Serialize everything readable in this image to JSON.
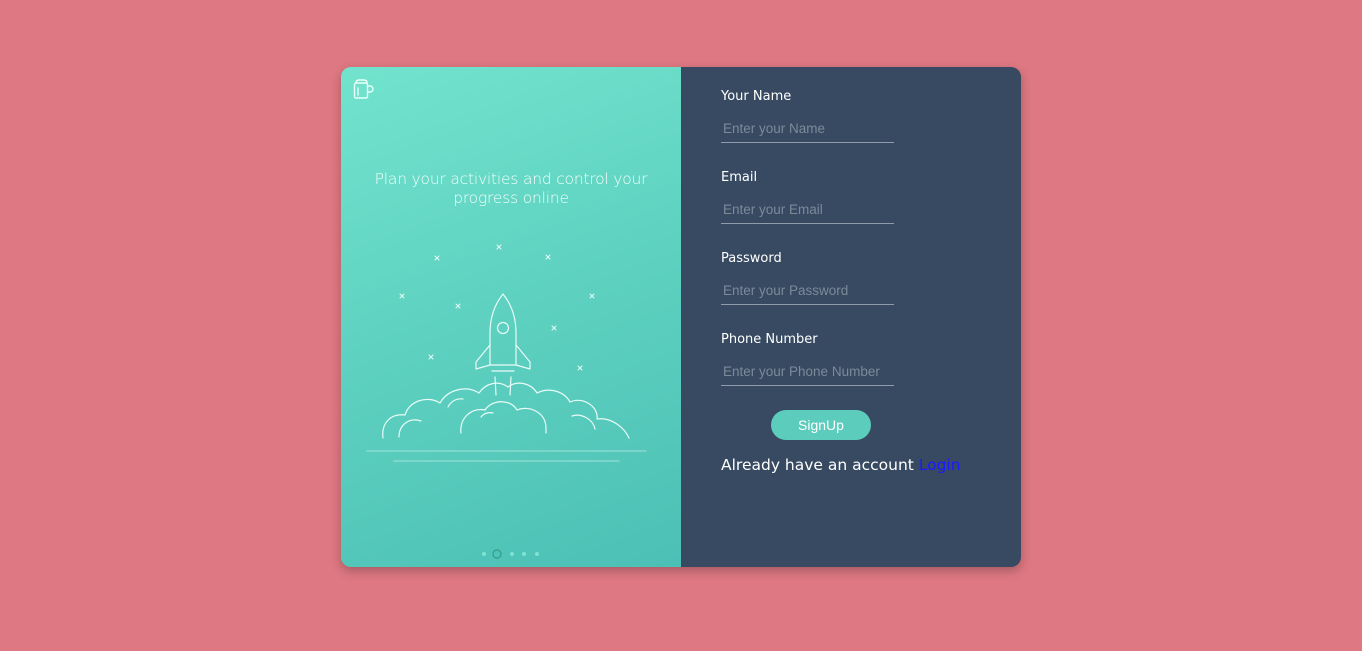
{
  "hero": {
    "logo_icon": "cup-icon",
    "tagline": "Plan your activities and control your progress online",
    "illustration_icon": "rocket-launch-illustration",
    "carousel": {
      "count": 5,
      "active_index": 1
    }
  },
  "form": {
    "fields": [
      {
        "label": "Your Name",
        "placeholder": "Enter your Name",
        "value": ""
      },
      {
        "label": "Email",
        "placeholder": "Enter your Email",
        "value": ""
      },
      {
        "label": "Password",
        "placeholder": "Enter your Password",
        "value": ""
      },
      {
        "label": "Phone Number",
        "placeholder": "Enter your Phone Number",
        "value": ""
      }
    ],
    "submit_label": "SignUp",
    "already_text": "Already have an account",
    "login_label": "Login"
  },
  "colors": {
    "page_background": "#de7882",
    "left_panel": "#5fd2c1",
    "right_panel": "#374a62",
    "button": "#5ccdbd",
    "login_link": "#1a1aff"
  }
}
